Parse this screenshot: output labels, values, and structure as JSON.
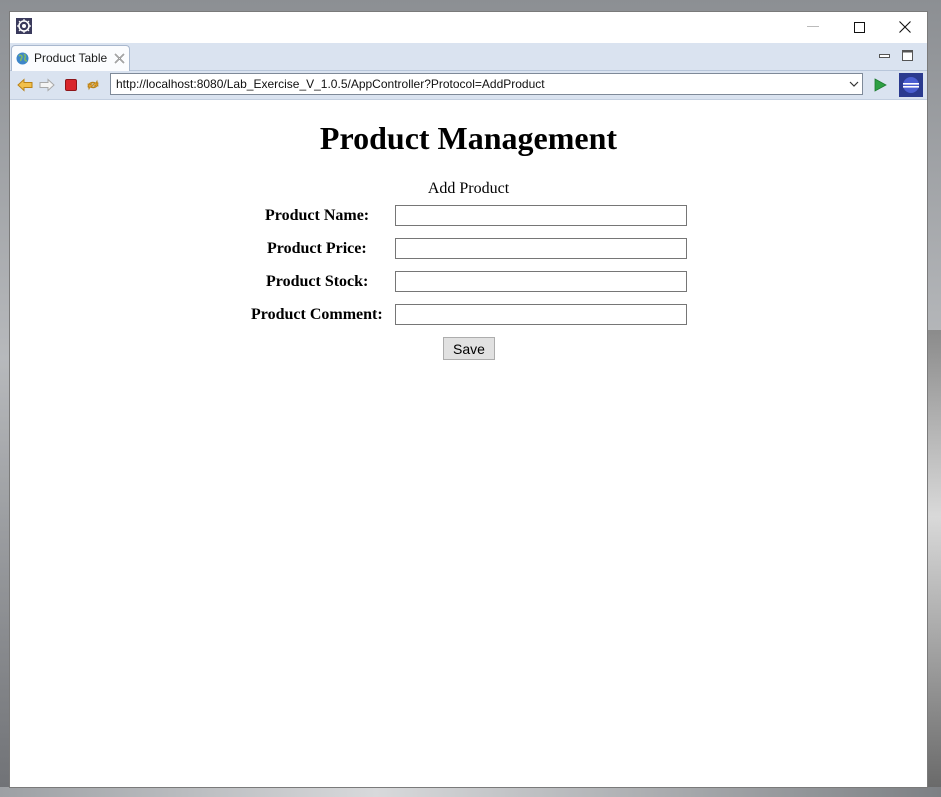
{
  "tab": {
    "label": "Product Table"
  },
  "address_bar": {
    "url": "http://localhost:8080/Lab_Exercise_V_1.0.5/AppController?Protocol=AddProduct"
  },
  "page": {
    "title": "Product Management",
    "form_caption": "Add Product",
    "fields": [
      {
        "label": "Product Name:",
        "value": ""
      },
      {
        "label": "Product Price:",
        "value": ""
      },
      {
        "label": "Product Stock:",
        "value": ""
      },
      {
        "label": "Product Comment:",
        "value": ""
      }
    ],
    "save_label": "Save"
  },
  "icons": {
    "app": "eclipse-app-icon",
    "back": "back-arrow-icon",
    "forward": "forward-arrow-icon",
    "stop": "stop-icon",
    "refresh": "refresh-icon",
    "go": "go-play-icon",
    "eclipse": "eclipse-icon"
  },
  "colors": {
    "chrome": "#dae3f0",
    "go_green": "#2ea043",
    "stop_red": "#d9262c",
    "nav_orange": "#e0a030"
  }
}
